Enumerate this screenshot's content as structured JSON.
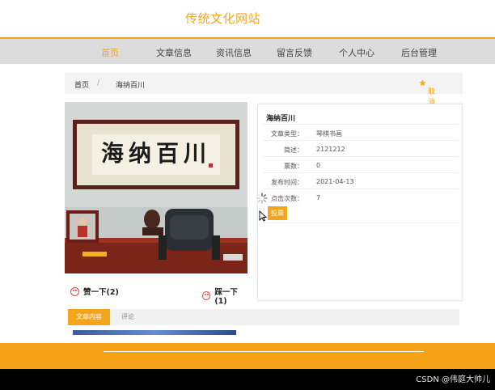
{
  "site": {
    "title": "传统文化网站"
  },
  "nav": [
    "首页",
    "文章信息",
    "资讯信息",
    "留言反馈",
    "个人中心",
    "后台管理"
  ],
  "breadcrumb": {
    "home": "首页",
    "separator": "/",
    "current": "海纳百川",
    "favorite": "取消收藏"
  },
  "article": {
    "title": "海纳百川",
    "fields": [
      {
        "label": "文章类型：",
        "value": "琴棋书画"
      },
      {
        "label": "简述：",
        "value": "2121212"
      },
      {
        "label": "票数：",
        "value": "0"
      },
      {
        "label": "发布时间：",
        "value": "2021-04-13"
      },
      {
        "label": "点击次数：",
        "value": "7"
      }
    ],
    "report_button": "投票"
  },
  "image": {
    "calligraphy": "海纳百川"
  },
  "votes": {
    "like": "赞一下(2)",
    "dislike": "踩一下(1)"
  },
  "tabs": [
    "文章内容",
    "评论"
  ],
  "watermark": "CSDN @伟庭大帅儿",
  "colors": {
    "accent": "#f4a51c",
    "nav_bg": "#dcdcdc",
    "footer": "#f6a317"
  }
}
